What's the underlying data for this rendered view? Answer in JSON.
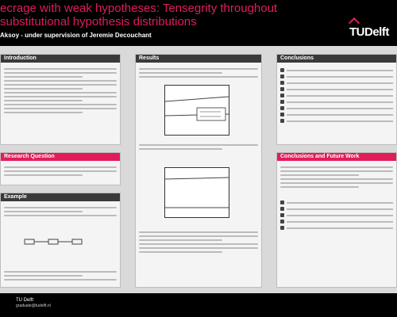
{
  "header": {
    "title": "ecrage with weak hypotheses: Tensegrity throughout\nsubstitutional hypothesis distributions",
    "author": "Aksoy - under supervision of Jeremie Decouchant",
    "logo": "TUDelft"
  },
  "panels": {
    "p1": "Introduction",
    "p2": "Research Question",
    "p3": "Example",
    "p4": "Results",
    "p5": "Conclusions",
    "p6": "Conclusions and Future Work"
  },
  "footer": {
    "line1": "TU Delft",
    "line2": "graduate@tudelft.nl"
  }
}
